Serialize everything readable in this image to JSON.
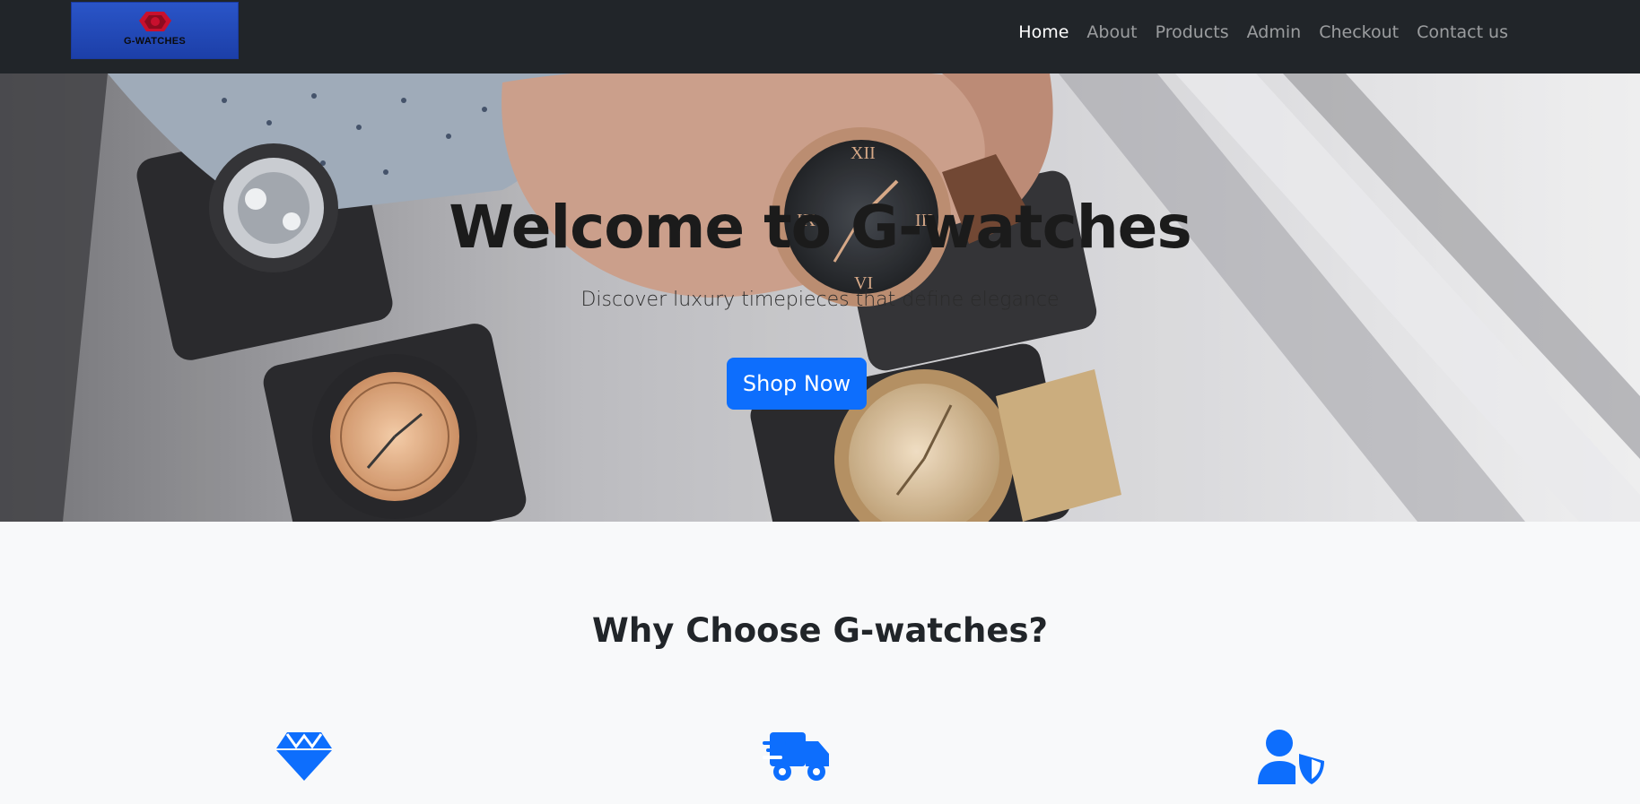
{
  "navbar": {
    "brand_text": "G-WATCHES",
    "links": [
      {
        "label": "Home",
        "active": true
      },
      {
        "label": "About"
      },
      {
        "label": "Products"
      },
      {
        "label": "Admin"
      },
      {
        "label": "Checkout"
      },
      {
        "label": "Contact us"
      }
    ]
  },
  "hero": {
    "title": "Welcome to G-watches",
    "subtitle": "Discover luxury timepieces that define elegance",
    "cta_label": "Shop Now"
  },
  "features": {
    "title": "Why Choose G-watches?",
    "icons": [
      "gem-icon",
      "shipping-fast-icon",
      "user-shield-icon"
    ]
  },
  "colors": {
    "navbar_bg": "#212529",
    "accent": "#0d6efd",
    "page_bg": "#f8f9fa"
  }
}
